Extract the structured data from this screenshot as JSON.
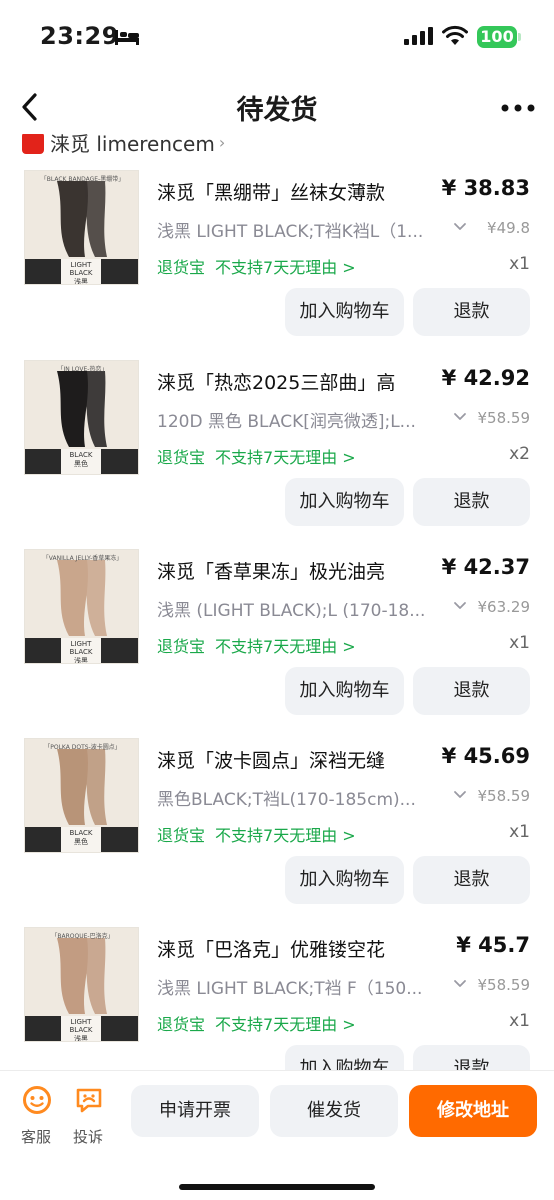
{
  "status_bar": {
    "time": "23:29",
    "battery": "100"
  },
  "nav": {
    "title": "待发货"
  },
  "shop": {
    "name": "涞觅 limerencem"
  },
  "items": [
    {
      "title": "涞觅「黑绷带」丝袜女薄款",
      "price": "¥ 38.83",
      "spec": "浅黑 LIGHT BLACK;T裆K裆L（1...",
      "original_price": "¥49.8",
      "guarantee": "退货宝",
      "return_policy": "不支持7天无理由 >",
      "qty": "x1",
      "cart_label": "加入购物车",
      "refund_label": "退款",
      "thumb_tag": "「BLACK BANDAGE-黑绷带」",
      "thumb_brand": "LIGHT BLACK",
      "thumb_brand_sub": "浅黑",
      "thumb_skin": "#3a3430"
    },
    {
      "title": "涞觅「热恋2025三部曲」高",
      "price": "¥ 42.92",
      "spec": "120D 黑色 BLACK[润亮微透];L...",
      "original_price": "¥58.59",
      "guarantee": "退货宝",
      "return_policy": "不支持7天无理由 >",
      "qty": "x2",
      "cart_label": "加入购物车",
      "refund_label": "退款",
      "thumb_tag": "「IN LOVE-热恋」",
      "thumb_brand": "BLACK",
      "thumb_brand_sub": "黑色",
      "thumb_skin": "#1e1c1c"
    },
    {
      "title": "涞觅「香草果冻」极光油亮",
      "price": "¥ 42.37",
      "spec": "浅黑 (LIGHT BLACK);L (170-18...",
      "original_price": "¥63.29",
      "guarantee": "退货宝",
      "return_policy": "不支持7天无理由 >",
      "qty": "x1",
      "cart_label": "加入购物车",
      "refund_label": "退款",
      "thumb_tag": "「VANILLA JELLY-香草果冻」",
      "thumb_brand": "LIGHT BLACK",
      "thumb_brand_sub": "浅黑",
      "thumb_skin": "#c9a68c"
    },
    {
      "title": "涞觅「波卡圆点」深裆无缝",
      "price": "¥ 45.69",
      "spec": "黑色BLACK;T裆L(170-185cm)...",
      "original_price": "¥58.59",
      "guarantee": "退货宝",
      "return_policy": "不支持7天无理由 >",
      "qty": "x1",
      "cart_label": "加入购物车",
      "refund_label": "退款",
      "thumb_tag": "「POLKA DOTS-波卡圆点」",
      "thumb_brand": "BLACK",
      "thumb_brand_sub": "黑色",
      "thumb_skin": "#b89478"
    },
    {
      "title": "涞觅「巴洛克」优雅镂空花",
      "price": "¥ 45.7",
      "spec": "浅黑 LIGHT BLACK;T裆 F（150...",
      "original_price": "¥58.59",
      "guarantee": "退货宝",
      "return_policy": "不支持7天无理由 >",
      "qty": "x1",
      "cart_label": "加入购物车",
      "refund_label": "退款",
      "thumb_tag": "「BAROQUE-巴洛克」",
      "thumb_brand": "LIGHT BLACK",
      "thumb_brand_sub": "浅黑",
      "thumb_skin": "#c29c82"
    }
  ],
  "bottom_bar": {
    "service_label": "客服",
    "complain_label": "投诉",
    "invoice_label": "申请开票",
    "urge_label": "催发货",
    "address_label": "修改地址"
  },
  "colors": {
    "accent": "#ff6a00",
    "guarantee_green": "#1aa84a",
    "icon_orange": "#ff8a1f",
    "battery_green": "#34c759"
  },
  "icons": [
    "bed-icon",
    "signal-icon",
    "wifi-icon",
    "back-icon",
    "more-icon",
    "chevron-down-icon",
    "customer-service-icon",
    "complaint-icon"
  ]
}
